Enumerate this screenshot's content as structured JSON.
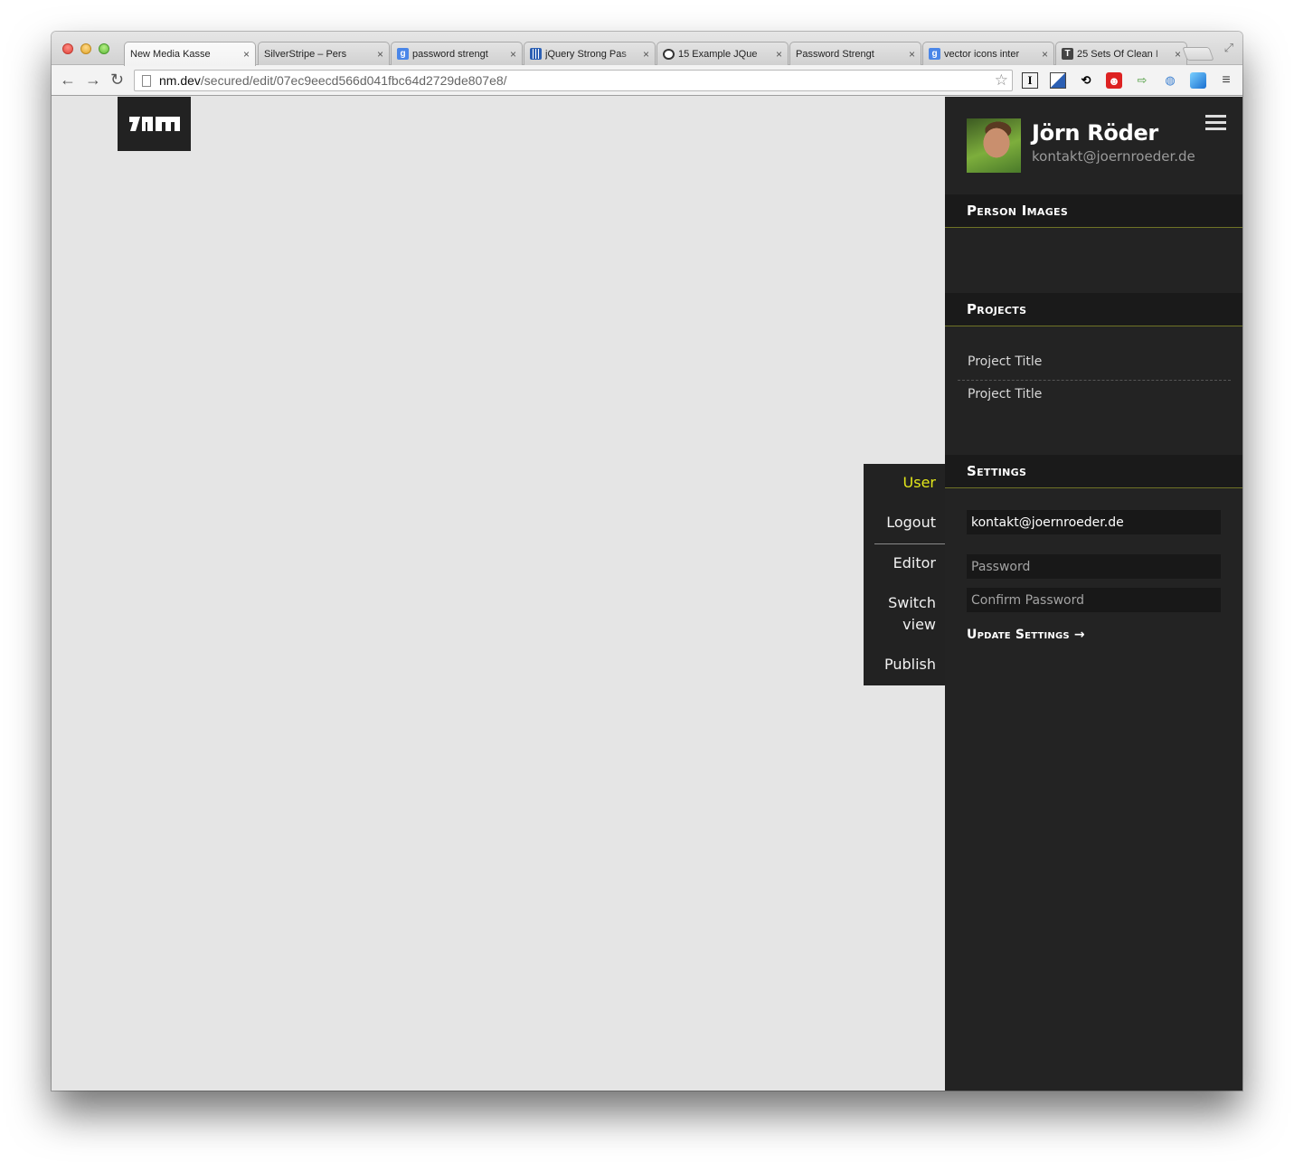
{
  "browser": {
    "tabs": [
      {
        "title": "New Media Kasse",
        "favicon": "page-icon",
        "active": true
      },
      {
        "title": "SilverStripe – Pers",
        "favicon": "page-icon",
        "active": false
      },
      {
        "title": "password strengt",
        "favicon": "google-icon",
        "active": false
      },
      {
        "title": "jQuery Strong Pas",
        "favicon": "grid-icon",
        "active": false
      },
      {
        "title": "15 Example JQue",
        "favicon": "ring-icon",
        "active": false
      },
      {
        "title": "Password Strengt",
        "favicon": "page-icon",
        "active": false
      },
      {
        "title": "vector icons inter",
        "favicon": "google-icon",
        "active": false
      },
      {
        "title": "25 Sets Of Clean I",
        "favicon": "t-icon",
        "active": false
      }
    ],
    "close_glyph": "×",
    "url_host": "nm.dev",
    "url_path": "/secured/edit/07ec9eecd566d041fbc64d2729de807e8/"
  },
  "flyout": {
    "items": [
      {
        "label": "User",
        "active": true
      },
      {
        "label": "Logout",
        "active": false
      },
      {
        "label": "Editor",
        "active": false
      },
      {
        "label": "Switch",
        "active": false
      },
      {
        "label": "view",
        "active": false
      },
      {
        "label": "Publish",
        "active": false
      }
    ]
  },
  "sidebar": {
    "user_name": "Jörn Röder",
    "user_email": "kontakt@joernroeder.de",
    "sections": {
      "person_images": "Person Images",
      "projects": "Projects",
      "settings": "Settings"
    },
    "projects": [
      "Project Title",
      "Project Title"
    ],
    "settings": {
      "email_value": "kontakt@joernroeder.de",
      "password_placeholder": "Password",
      "confirm_placeholder": "Confirm Password",
      "update_label": "Update Settings →"
    }
  },
  "colors": {
    "accent_yellow": "#e3e71a",
    "sidebar_bg": "#232323",
    "page_bg": "#e5e5e5"
  }
}
